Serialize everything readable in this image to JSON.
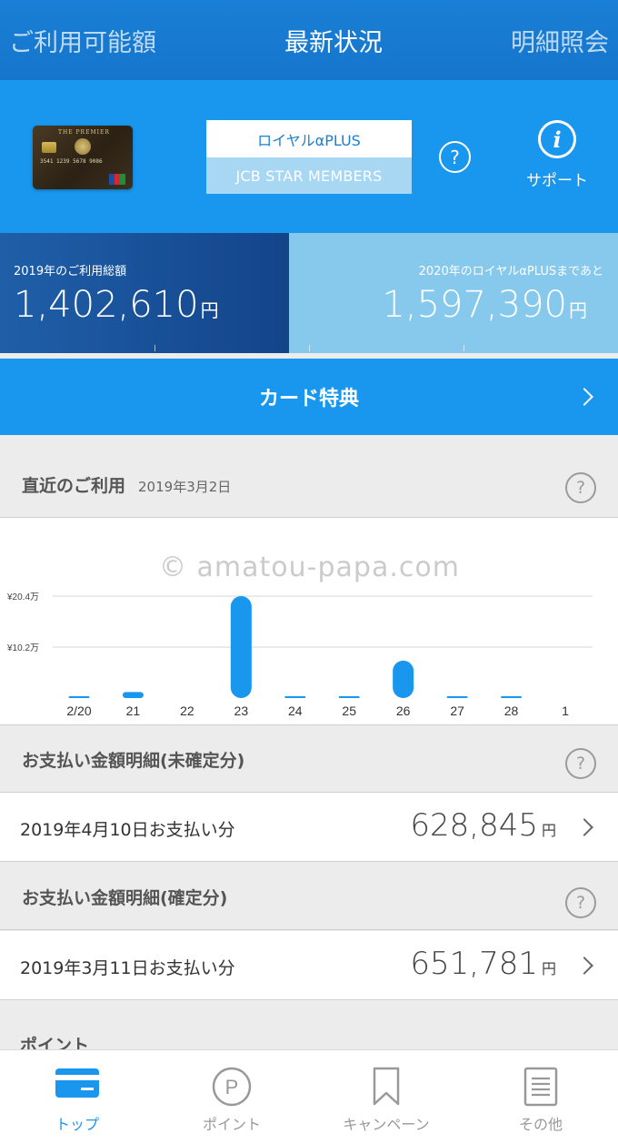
{
  "header": {
    "tabs": [
      {
        "label": "ご利用可能額",
        "active": false
      },
      {
        "label": "最新状況",
        "active": true
      },
      {
        "label": "明細照会",
        "active": false
      }
    ]
  },
  "card": {
    "brand_text": "THE PREMIER",
    "number_text": "3541 1239 5678 9086",
    "rank_name": "ロイヤルαPLUS",
    "program_name": "JCB STAR MEMBERS",
    "help_icon": "question-circle-icon",
    "support_label": "サポート",
    "support_icon": "info-icon"
  },
  "stats": {
    "total_label": "2019年のご利用総額",
    "total_value": "1,402,610",
    "total_unit": "円",
    "remaining_label": "2020年のロイヤルαPLUSまであと",
    "remaining_value": "1,597,390",
    "remaining_unit": "円"
  },
  "benefits": {
    "label": "カード特典"
  },
  "recent": {
    "title": "直近のご利用",
    "date": "2019年3月2日",
    "watermark": "© amatou-papa.com"
  },
  "chart_data": {
    "type": "bar",
    "categories": [
      "2/20",
      "21",
      "22",
      "23",
      "24",
      "25",
      "26",
      "27",
      "28",
      "1"
    ],
    "values": [
      0.35,
      1.2,
      0.0,
      20.4,
      0.35,
      0.05,
      7.5,
      0.05,
      0.1,
      0.0
    ],
    "y_unit": "万円",
    "ytick_labels": [
      "¥20.4万",
      "¥10.2万"
    ],
    "ytick_values": [
      20.4,
      10.2
    ],
    "ylim": [
      0,
      20.4
    ],
    "grid": true,
    "bar_color": "#1996ee"
  },
  "unconfirmed": {
    "title": "お支払い金額明細(未確定分)",
    "desc": "2019年4月10日お支払い分",
    "amount": "628,845",
    "unit": "円"
  },
  "confirmed": {
    "title": "お支払い金額明細(確定分)",
    "desc": "2019年3月11日お支払い分",
    "amount": "651,781",
    "unit": "円"
  },
  "points_section": {
    "title": "ポイント"
  },
  "bottom_nav": [
    {
      "label": "トップ",
      "icon": "card-icon",
      "active": true
    },
    {
      "label": "ポイント",
      "icon": "p-circle-icon",
      "active": false
    },
    {
      "label": "キャンペーン",
      "icon": "bookmark-icon",
      "active": false
    },
    {
      "label": "その他",
      "icon": "list-icon",
      "active": false
    }
  ],
  "colors": {
    "accent": "#1996ee",
    "header_bar": "#1575cc",
    "total_panel": "#13448a",
    "remaining_panel": "#86c9ec"
  }
}
